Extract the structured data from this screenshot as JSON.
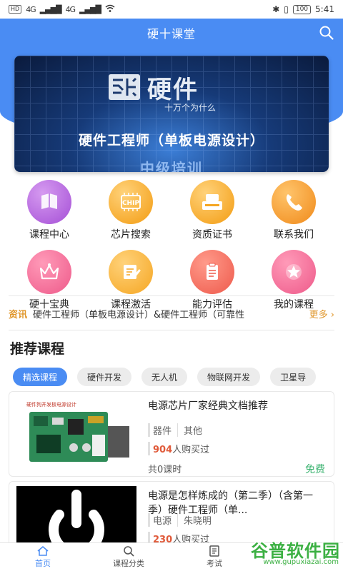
{
  "status_bar": {
    "left_chips": [
      "HD",
      "4G",
      "4G"
    ],
    "battery": "100",
    "time": "5:41"
  },
  "header": {
    "title": "硬十课堂",
    "search_icon": "search-icon"
  },
  "banner": {
    "brand": "硬件",
    "slogan": "十万个为什么",
    "course": "硬件工程师（单板电源设计）",
    "level": "中级培训"
  },
  "grid": [
    {
      "label": "课程中心",
      "icon": "book-icon",
      "color": "#b56be0"
    },
    {
      "label": "芯片搜索",
      "icon": "chip-icon",
      "color": "#f5a623"
    },
    {
      "label": "资质证书",
      "icon": "certificate-icon",
      "color": "#f5a623"
    },
    {
      "label": "联系我们",
      "icon": "phone-icon",
      "color": "#f5a623"
    },
    {
      "label": "硬十宝典",
      "icon": "crown-icon",
      "color": "#f06292"
    },
    {
      "label": "课程激活",
      "icon": "edit-icon",
      "color": "#f5a623"
    },
    {
      "label": "能力评估",
      "icon": "clipboard-icon",
      "color": "#f0605c"
    },
    {
      "label": "我的课程",
      "icon": "star-icon",
      "color": "#f06292"
    }
  ],
  "news": {
    "tag": "资讯",
    "text": "硬件工程师（单板电源设计）&硬件工程师（可靠性",
    "more": "更多 ›"
  },
  "recommend": {
    "title": "推荐课程",
    "chips": [
      "精选课程",
      "硬件开发",
      "无人机",
      "物联网开发",
      "卫星导"
    ]
  },
  "courses": [
    {
      "title": "电源芯片厂家经典文档推荐",
      "tags": [
        "器件",
        "其他"
      ],
      "buy_count": "904",
      "buy_suffix": "人购买过",
      "lessons": "共0课时",
      "price": "免费",
      "thumb_caption": "硬件狗开发板电源设计"
    },
    {
      "title": "电源是怎样炼成的（第二季）（含第一季）硬件工程师（单...",
      "tags": [
        "电源",
        "朱晓明"
      ],
      "buy_count": "230",
      "buy_suffix": "人购买过"
    }
  ],
  "bottom_nav": [
    {
      "label": "首页",
      "icon": "home-icon",
      "active": true
    },
    {
      "label": "课程分类",
      "icon": "search-icon",
      "active": false
    },
    {
      "label": "考试",
      "icon": "exam-icon",
      "active": false
    }
  ],
  "watermark": {
    "big": "谷普软件园",
    "small": "www.gupuxiazai.com"
  },
  "colors": {
    "primary": "#4a8cf3",
    "accent": "#e0962a",
    "free": "#3cb371",
    "count": "#e05a3a"
  }
}
